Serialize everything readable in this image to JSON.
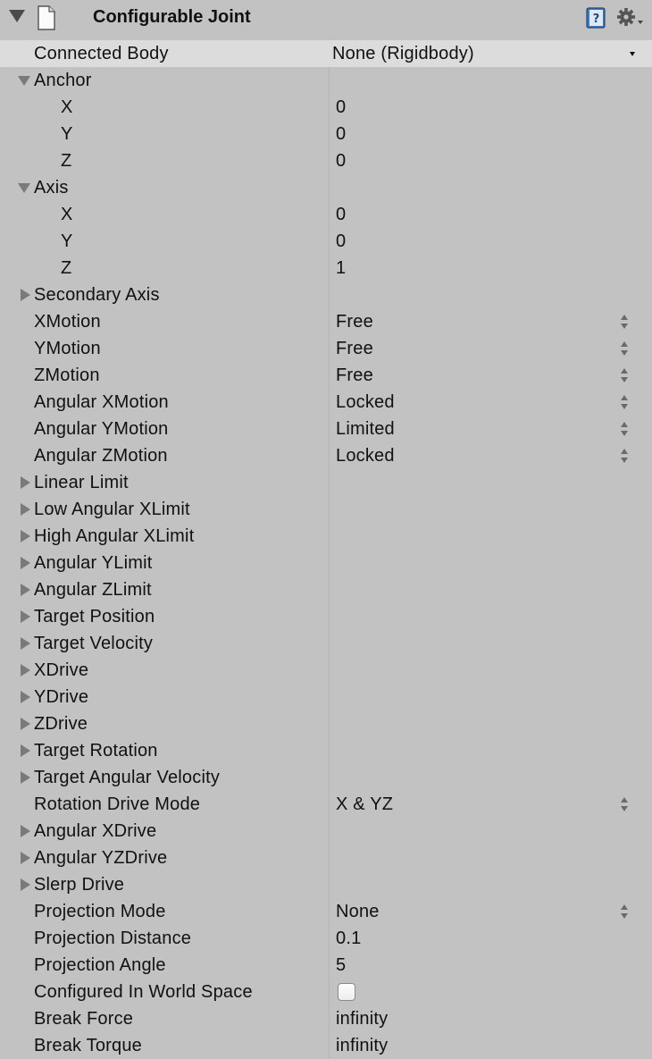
{
  "header": {
    "title": "Configurable Joint",
    "icons": [
      "fold-arrow-icon",
      "script-document-icon",
      "help-book-icon",
      "gear-dropdown-icon"
    ]
  },
  "rows": [
    {
      "name": "connected-body",
      "label": "Connected Body",
      "value": "None (Rigidbody)",
      "control": "object-field",
      "selected": true
    },
    {
      "name": "anchor",
      "label": "Anchor",
      "fold": "expanded"
    },
    {
      "name": "anchor-x",
      "label": "X",
      "value": "0",
      "indent": true
    },
    {
      "name": "anchor-y",
      "label": "Y",
      "value": "0",
      "indent": true
    },
    {
      "name": "anchor-z",
      "label": "Z",
      "value": "0",
      "indent": true
    },
    {
      "name": "axis",
      "label": "Axis",
      "fold": "expanded"
    },
    {
      "name": "axis-x",
      "label": "X",
      "value": "0",
      "indent": true
    },
    {
      "name": "axis-y",
      "label": "Y",
      "value": "0",
      "indent": true
    },
    {
      "name": "axis-z",
      "label": "Z",
      "value": "1",
      "indent": true
    },
    {
      "name": "secondary-axis",
      "label": "Secondary Axis",
      "fold": "collapsed"
    },
    {
      "name": "xmotion",
      "label": "XMotion",
      "value": "Free",
      "control": "popup"
    },
    {
      "name": "ymotion",
      "label": "YMotion",
      "value": "Free",
      "control": "popup"
    },
    {
      "name": "zmotion",
      "label": "ZMotion",
      "value": "Free",
      "control": "popup"
    },
    {
      "name": "angular-xmotion",
      "label": "Angular XMotion",
      "value": "Locked",
      "control": "popup"
    },
    {
      "name": "angular-ymotion",
      "label": "Angular YMotion",
      "value": "Limited",
      "control": "popup"
    },
    {
      "name": "angular-zmotion",
      "label": "Angular ZMotion",
      "value": "Locked",
      "control": "popup"
    },
    {
      "name": "linear-limit",
      "label": "Linear Limit",
      "fold": "collapsed"
    },
    {
      "name": "low-angular-xlimit",
      "label": "Low Angular XLimit",
      "fold": "collapsed"
    },
    {
      "name": "high-angular-xlimit",
      "label": "High Angular XLimit",
      "fold": "collapsed"
    },
    {
      "name": "angular-ylimit",
      "label": "Angular YLimit",
      "fold": "collapsed"
    },
    {
      "name": "angular-zlimit",
      "label": "Angular ZLimit",
      "fold": "collapsed"
    },
    {
      "name": "target-position",
      "label": "Target Position",
      "fold": "collapsed"
    },
    {
      "name": "target-velocity",
      "label": "Target Velocity",
      "fold": "collapsed"
    },
    {
      "name": "xdrive",
      "label": "XDrive",
      "fold": "collapsed"
    },
    {
      "name": "ydrive",
      "label": "YDrive",
      "fold": "collapsed"
    },
    {
      "name": "zdrive",
      "label": "ZDrive",
      "fold": "collapsed"
    },
    {
      "name": "target-rotation",
      "label": "Target Rotation",
      "fold": "collapsed"
    },
    {
      "name": "target-angular-velocity",
      "label": "Target Angular Velocity",
      "fold": "collapsed"
    },
    {
      "name": "rotation-drive-mode",
      "label": "Rotation Drive Mode",
      "value": "X & YZ",
      "control": "popup"
    },
    {
      "name": "angular-xdrive",
      "label": "Angular XDrive",
      "fold": "collapsed"
    },
    {
      "name": "angular-yzdrive",
      "label": "Angular YZDrive",
      "fold": "collapsed"
    },
    {
      "name": "slerp-drive",
      "label": "Slerp Drive",
      "fold": "collapsed"
    },
    {
      "name": "projection-mode",
      "label": "Projection Mode",
      "value": "None",
      "control": "popup"
    },
    {
      "name": "projection-distance",
      "label": "Projection Distance",
      "value": "0.1"
    },
    {
      "name": "projection-angle",
      "label": "Projection Angle",
      "value": "5"
    },
    {
      "name": "configured-in-world-space",
      "label": "Configured In World Space",
      "control": "checkbox",
      "checked": false
    },
    {
      "name": "break-force",
      "label": "Break Force",
      "value": "infinity"
    },
    {
      "name": "break-torque",
      "label": "Break Torque",
      "value": "infinity"
    }
  ]
}
